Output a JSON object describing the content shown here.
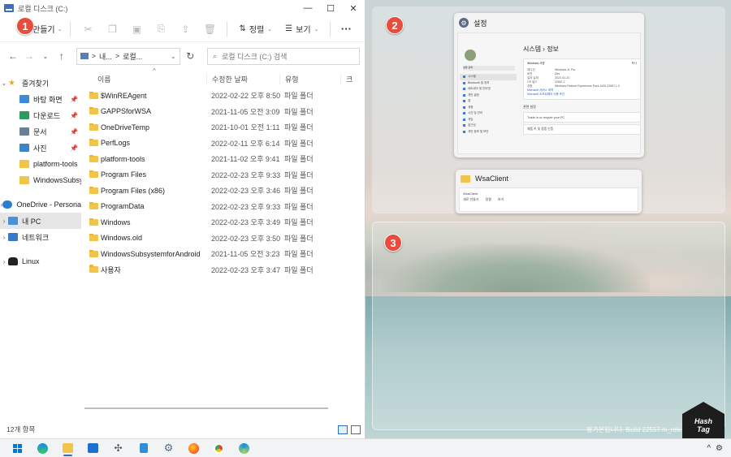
{
  "window": {
    "title": "로컬 디스크 (C:)",
    "controls": [
      "—",
      "☐",
      "✕"
    ]
  },
  "toolbar": {
    "new_label": "만들기",
    "sort_label": "정렬",
    "view_label": "보기",
    "more_label": "···"
  },
  "address": {
    "path_part1": "내...",
    "sep": ">",
    "path_part2": "로컬...",
    "search_placeholder": "로컬 디스크 (C:) 검색"
  },
  "nav": {
    "quick_access": "즐겨찾기",
    "items": [
      {
        "label": "바탕 화면",
        "pinned": true
      },
      {
        "label": "다운로드",
        "pinned": true
      },
      {
        "label": "문서",
        "pinned": true
      },
      {
        "label": "사진",
        "pinned": true
      },
      {
        "label": "platform-tools",
        "pinned": false
      },
      {
        "label": "WindowsSubsyste",
        "pinned": false
      }
    ],
    "onedrive": "OneDrive - Persona",
    "this_pc": "내 PC",
    "network": "네트워크",
    "linux": "Linux"
  },
  "columns": {
    "name": "이름",
    "modified": "수정한 날짜",
    "type": "유형",
    "size": "크"
  },
  "files": [
    {
      "name": "$WinREAgent",
      "date": "2022-02-22 오후 8:50",
      "type": "파일 폴더"
    },
    {
      "name": "GAPPSforWSA",
      "date": "2021-11-05 오전 3:09",
      "type": "파일 폴더"
    },
    {
      "name": "OneDriveTemp",
      "date": "2021-10-01 오전 1:11",
      "type": "파일 폴더"
    },
    {
      "name": "PerfLogs",
      "date": "2022-02-11 오후 6:14",
      "type": "파일 폴더"
    },
    {
      "name": "platform-tools",
      "date": "2021-11-02 오후 9:41",
      "type": "파일 폴더"
    },
    {
      "name": "Program Files",
      "date": "2022-02-23 오후 9:33",
      "type": "파일 폴더"
    },
    {
      "name": "Program Files (x86)",
      "date": "2022-02-23 오후 3:46",
      "type": "파일 폴더"
    },
    {
      "name": "ProgramData",
      "date": "2022-02-23 오후 9:33",
      "type": "파일 폴더"
    },
    {
      "name": "Windows",
      "date": "2022-02-23 오후 3:49",
      "type": "파일 폴더"
    },
    {
      "name": "Windows.old",
      "date": "2022-02-23 오후 3:50",
      "type": "파일 폴더"
    },
    {
      "name": "WindowsSubsystemforAndroid",
      "date": "2021-11-05 오전 3:23",
      "type": "파일 폴더"
    },
    {
      "name": "사용자",
      "date": "2022-02-23 오후 3:47",
      "type": "파일 폴더"
    }
  ],
  "status": {
    "count": "12개 항목"
  },
  "snap": {
    "settings_title": "설정",
    "settings_breadcrumb": "시스템 › 정보",
    "settings_search": "설정 검색",
    "settings_menu": [
      "시스템",
      "Bluetooth 및 장치",
      "네트워크 및 인터넷",
      "개인 설정",
      "앱",
      "계정",
      "시간 및 언어",
      "게임",
      "접근성",
      "개인 정보 및 보안"
    ],
    "spec_header": "Windows 사양",
    "spec_copy": "복사",
    "spec_rows": [
      {
        "k": "에디션",
        "v": "Windows 11 Pro"
      },
      {
        "k": "버전",
        "v": "Dev"
      },
      {
        "k": "설치 날짜",
        "v": "2022-02-23"
      },
      {
        "k": "OS 빌드",
        "v": "22557.1"
      },
      {
        "k": "경험",
        "v": "Windows Feature Experience Pack 1000.22557.1.0"
      }
    ],
    "spec_link1": "Microsoft 서비스 계약",
    "spec_link2": "Microsoft 소프트웨어 사용 조건",
    "related_label": "관련 설정",
    "related_rows": [
      "Trade-in or recycle your PC",
      "제품 키 및 정품 인증"
    ],
    "wsa_title": "WsaClient",
    "wsa_folder": "WsaClient",
    "wsa_toolbar": [
      "새로 만들기",
      "정렬",
      "보기"
    ]
  },
  "badges": [
    "1",
    "2",
    "3"
  ],
  "desktop": {
    "build_text": "평가본입니다. Build 22557.ni_rele",
    "logo_line1": "Hash",
    "logo_line2": "Tag"
  },
  "taskbar": {
    "apps": [
      "start-icon",
      "edge-icon",
      "file-explorer-icon",
      "mail-icon",
      "snip-icon",
      "notepad-icon",
      "settings-icon",
      "firefox-icon",
      "chrome-icon",
      "edge-beta-icon"
    ],
    "tray": [
      "^",
      "⚙"
    ]
  },
  "colors": {
    "accent": "#2b6cc4",
    "badge": "#e74c3c",
    "folder": "#f2c54a"
  }
}
